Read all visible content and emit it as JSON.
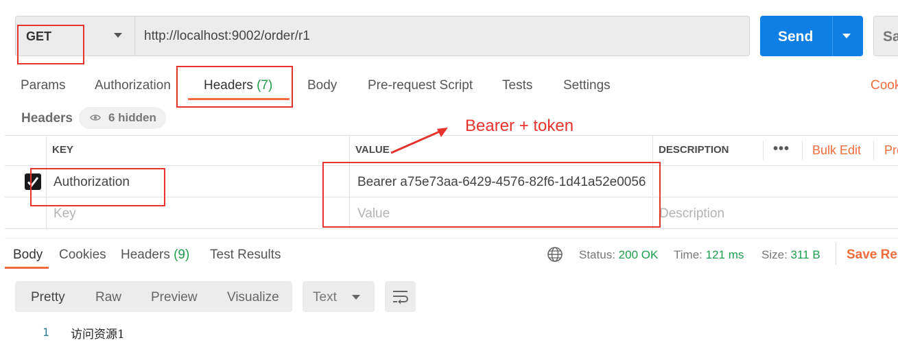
{
  "request": {
    "method": "GET",
    "url": "http://localhost:9002/order/r1",
    "send_label": "Send",
    "save_label": "Sa"
  },
  "request_tabs": {
    "params": "Params",
    "authorization": "Authorization",
    "headers": "Headers",
    "headers_count": "(7)",
    "body": "Body",
    "pre_request_script": "Pre-request Script",
    "tests": "Tests",
    "settings": "Settings",
    "cookies": "Cook"
  },
  "headers_section": {
    "title": "Headers",
    "hidden_label": "6 hidden",
    "columns": {
      "key": "KEY",
      "value": "VALUE",
      "description": "DESCRIPTION"
    },
    "more_label": "•••",
    "bulk_edit": "Bulk Edit",
    "presets": "Pre",
    "rows": [
      {
        "checked": true,
        "key": "Authorization",
        "value": "Bearer a75e73aa-6429-4576-82f6-1d41a52e0056",
        "description": ""
      }
    ],
    "placeholders": {
      "key": "Key",
      "value": "Value",
      "description": "Description"
    }
  },
  "annotation": {
    "text": "Bearer + token",
    "color": "#e8332d"
  },
  "response_tabs": {
    "body": "Body",
    "cookies": "Cookies",
    "headers": "Headers",
    "headers_count": "(9)",
    "test_results": "Test Results"
  },
  "response_status": {
    "status_label": "Status:",
    "status_value": "200 OK",
    "time_label": "Time:",
    "time_value": "121 ms",
    "size_label": "Size:",
    "size_value": "311 B",
    "save_response": "Save Res"
  },
  "response_view": {
    "options": [
      "Pretty",
      "Raw",
      "Preview",
      "Visualize"
    ],
    "active": "Pretty",
    "format": "Text"
  },
  "response_body": {
    "lines": [
      {
        "number": "1",
        "text": "访问资源1"
      }
    ]
  },
  "colors": {
    "accent_orange": "#f26b3a",
    "send_blue": "#0f7ee5",
    "success_green": "#1c9e4c"
  }
}
